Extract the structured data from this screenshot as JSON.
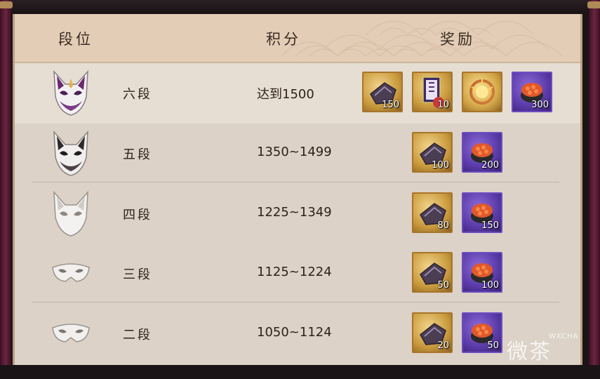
{
  "header": {
    "col_rank": "段位",
    "col_score": "积分",
    "col_reward": "奖励"
  },
  "rows": [
    {
      "rank": "六段",
      "score": "达到1500",
      "mask": "fox-mask-purple-icon",
      "rewards": [
        {
          "icon": "amulet-icon",
          "frame": "gold",
          "qty": "150"
        },
        {
          "icon": "ticket-icon",
          "frame": "gold",
          "qty": "10"
        },
        {
          "icon": "fire-frame-icon",
          "frame": "gold",
          "qty": ""
        },
        {
          "icon": "sushi-icon",
          "frame": "purple",
          "qty": "300"
        }
      ]
    },
    {
      "rank": "五段",
      "score": "1350~1499",
      "mask": "fox-mask-black-icon",
      "rewards": [
        {
          "icon": "amulet-icon",
          "frame": "gold",
          "qty": "100"
        },
        {
          "icon": "sushi-icon",
          "frame": "purple",
          "qty": "200"
        }
      ]
    },
    {
      "rank": "四段",
      "score": "1225~1349",
      "mask": "fox-mask-white-icon",
      "rewards": [
        {
          "icon": "amulet-icon",
          "frame": "gold",
          "qty": "80"
        },
        {
          "icon": "sushi-icon",
          "frame": "purple",
          "qty": "150"
        }
      ]
    },
    {
      "rank": "三段",
      "score": "1125~1224",
      "mask": "half-mask-icon",
      "rewards": [
        {
          "icon": "amulet-icon",
          "frame": "gold",
          "qty": "50"
        },
        {
          "icon": "sushi-icon",
          "frame": "purple",
          "qty": "100"
        }
      ]
    },
    {
      "rank": "二段",
      "score": "1050~1124",
      "mask": "half-mask-icon",
      "rewards": [
        {
          "icon": "amulet-icon",
          "frame": "gold",
          "qty": "20"
        },
        {
          "icon": "sushi-icon",
          "frame": "purple",
          "qty": "50"
        }
      ]
    }
  ],
  "watermark": {
    "text": "微茶",
    "url": "WXCHA"
  },
  "colors": {
    "panel": "#dcd2c7",
    "header": "#e4cdb7",
    "rail": "#6a2540",
    "gold_frame": "#c99a3d",
    "purple_frame": "#5a3aa8"
  }
}
